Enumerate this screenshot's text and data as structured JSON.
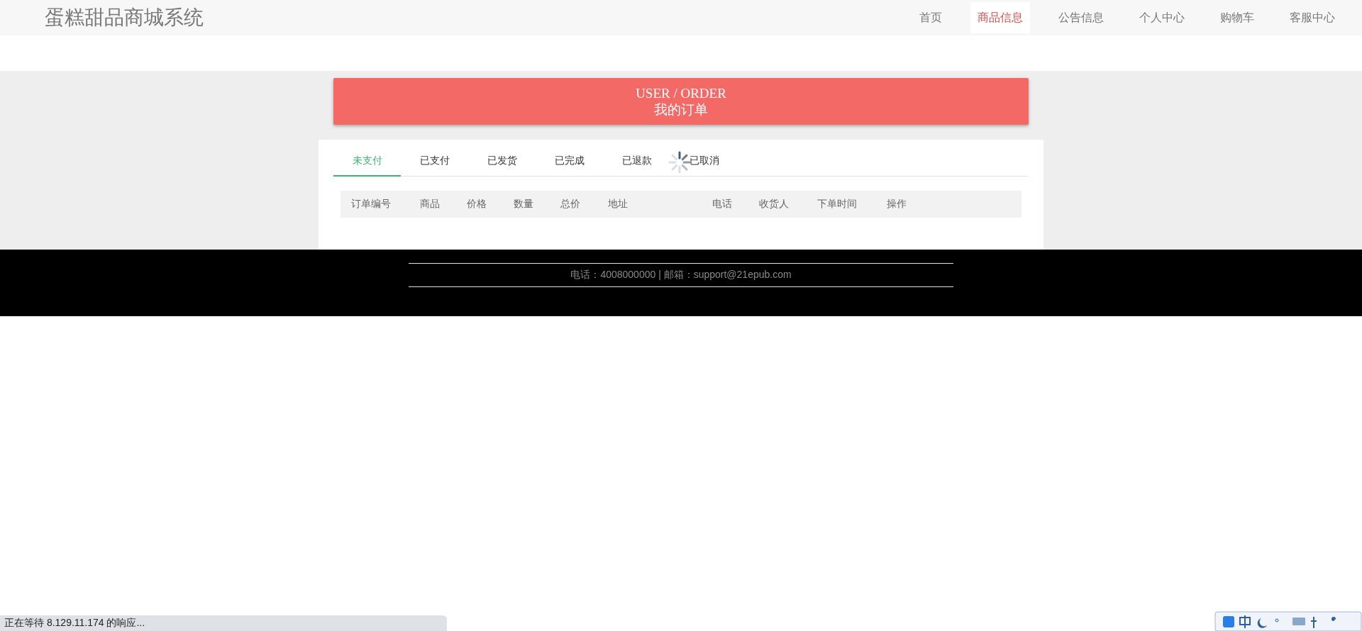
{
  "site_title": "蛋糕甜品商城系统",
  "nav": [
    {
      "label": "首页",
      "selected": false
    },
    {
      "label": "商品信息",
      "selected": true
    },
    {
      "label": "公告信息",
      "selected": false
    },
    {
      "label": "个人中心",
      "selected": false
    },
    {
      "label": "购物车",
      "selected": false
    },
    {
      "label": "客服中心",
      "selected": false
    }
  ],
  "banner": {
    "title_en": "USER / ORDER",
    "title": "我的订单"
  },
  "order_tabs": [
    {
      "label": "未支付",
      "selected": true
    },
    {
      "label": "已支付",
      "selected": false
    },
    {
      "label": "已发货",
      "selected": false
    },
    {
      "label": "已完成",
      "selected": false
    },
    {
      "label": "已退款",
      "selected": false
    },
    {
      "label": "已取消",
      "selected": false
    }
  ],
  "table": {
    "columns": [
      "订单编号",
      "商品",
      "价格",
      "数量",
      "总价",
      "地址",
      "电话",
      "收货人",
      "下单时间",
      "操作"
    ]
  },
  "footer": {
    "contact": "电话：4008000000 | 邮箱：support@21epub.com"
  },
  "status_bar": "正在等待 8.129.11.174 的响应..."
}
